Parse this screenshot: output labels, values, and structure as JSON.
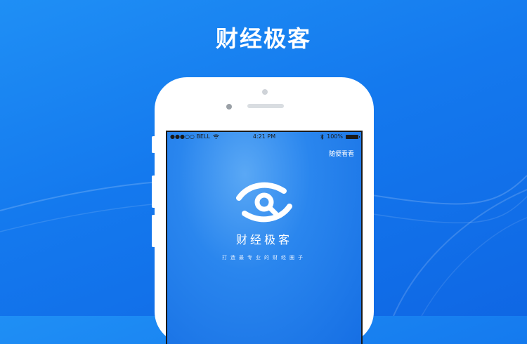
{
  "headline": "财经极客",
  "status_bar": {
    "carrier": "●●●○○ BELL",
    "time": "4:21 PM",
    "battery_text": "100%",
    "battery_level": 1.0,
    "icons": [
      "wifi-icon",
      "bluetooth-icon",
      "battery-icon"
    ]
  },
  "screen": {
    "top_link": "随便看看",
    "logo_name": "eye-logo-icon",
    "app_name": "财经极客",
    "slogan": "打造最专业的财经圈子"
  },
  "colors": {
    "background": "#1479ee",
    "phone_body": "#ffffff",
    "screen_bg": "#2a86ee",
    "text": "#ffffff"
  }
}
